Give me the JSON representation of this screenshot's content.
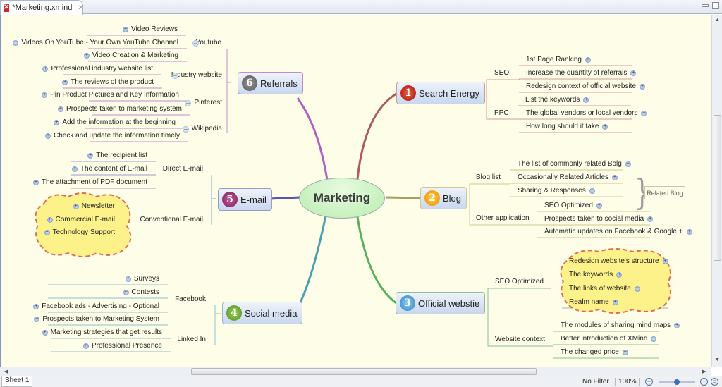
{
  "window": {
    "tab_title": "*Marketing.xmind",
    "logo_icon": "xmind-logo-icon",
    "close_icon": "close-icon"
  },
  "central_topic": "Marketing",
  "branches": {
    "referrals": {
      "number": "6",
      "label": "Referrals",
      "color": "#b060c0",
      "subtopics": [
        {
          "label": "Youtube",
          "items": [
            "Video Reviews",
            "Videos On YouTube - Your Own YouTube Channel",
            "Video Creation & Marketing"
          ]
        },
        {
          "label": "Industry website",
          "items": [
            "Professional industry website list",
            "The reviews of the product"
          ]
        },
        {
          "label": "Pinterest",
          "items": [
            "Pin Product Pictures and Key Information",
            "Prospects taken to marketing system"
          ]
        },
        {
          "label": "Wikipedia",
          "items": [
            "Add the information at the beginning",
            "Check and update the information timely"
          ]
        }
      ]
    },
    "email": {
      "number": "5",
      "label": "E-mail",
      "color": "#5656b0",
      "subtopics": [
        {
          "label": "Direct E-mail",
          "items": [
            "The recipient list",
            "The content of E-mail",
            "The attachment of PDF document"
          ]
        },
        {
          "label": "Conventional E-mail",
          "items": [
            "Newsletter",
            "Commercial E-mail",
            "Technology Support"
          ]
        }
      ]
    },
    "social": {
      "number": "4",
      "label": "Social media",
      "color": "#4aa0b0",
      "subtopics": [
        {
          "label": "Facebook",
          "items": [
            "Surveys",
            "Contests",
            "Facebook ads - Advertising - Optional",
            "Prospects taken to Marketing System"
          ]
        },
        {
          "label": "Linked In",
          "items": [
            "Marketing strategies that get results",
            "Professional Presence"
          ]
        }
      ]
    },
    "search": {
      "number": "1",
      "label": "Search Energy",
      "color": "#b05a5a",
      "subtopics": [
        {
          "label": "SEO",
          "items": [
            "1st Page Ranking",
            "Increase the quantity of referrals",
            "Redesign context of official website"
          ]
        },
        {
          "label": "PPC",
          "items": [
            "List the keywords",
            "The global vendors or local vendors",
            "How long should it take"
          ]
        }
      ]
    },
    "blog": {
      "number": "2",
      "label": "Blog",
      "color": "#a8a060",
      "subtopics": [
        {
          "label": "Blog list",
          "items": [
            "The list of commonly related Bolg",
            "Occasionally Related Articles",
            "Sharing & Responses"
          ]
        },
        {
          "label": "Other application",
          "items": [
            "SEO Optimized",
            "Prospects taken to social media",
            "Automatic updates on Facebook & Google +"
          ]
        }
      ],
      "summary": "Related Blog"
    },
    "official": {
      "number": "3",
      "label": "Official webstie",
      "color": "#5ab05a",
      "subtopics": [
        {
          "label": "SEO Optimized",
          "items": [
            "Redesign website's structure",
            "The keywords",
            "The links of website",
            "Realm name"
          ]
        },
        {
          "label": "Website context",
          "items": [
            "The modules of sharing mind maps",
            "Better introduction of XMind",
            "The changed price"
          ]
        }
      ]
    }
  },
  "status": {
    "sheet_tab": "Sheet 1",
    "filter": "No Filter",
    "zoom": "100%",
    "zoom_slider_fraction": 0.5
  }
}
